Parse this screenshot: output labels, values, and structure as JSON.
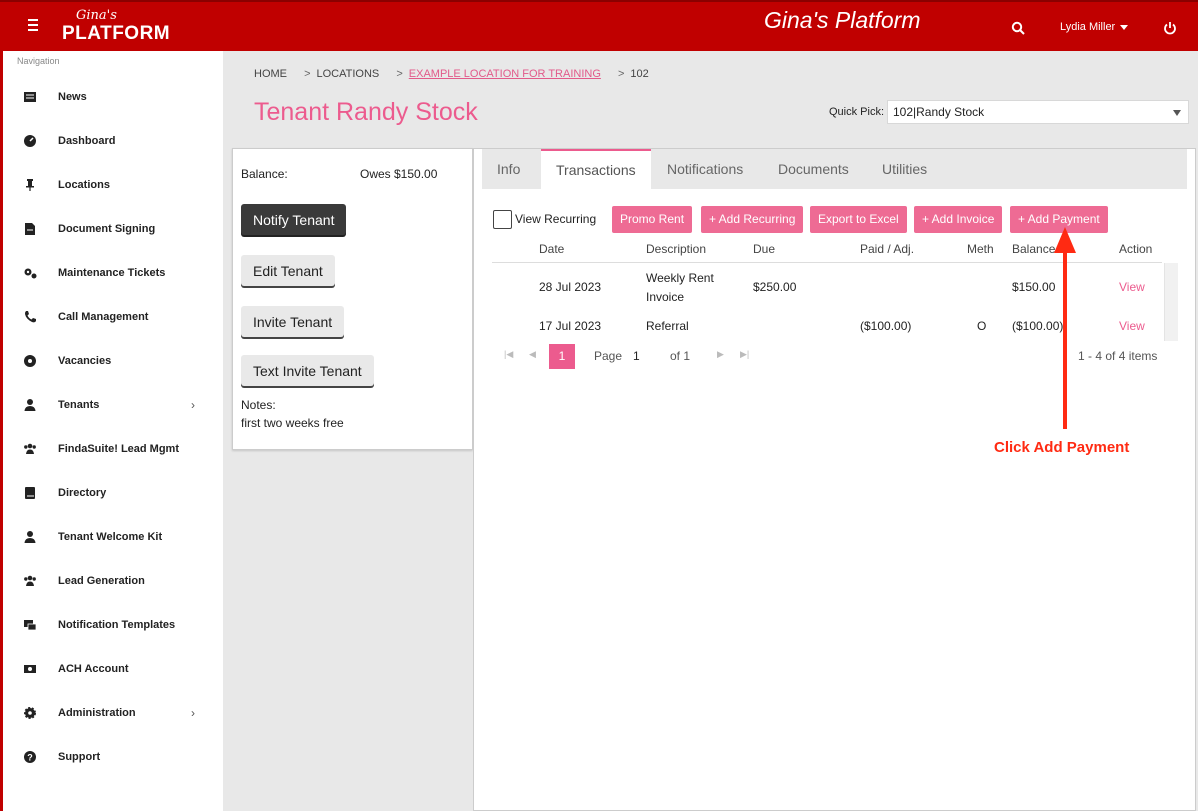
{
  "header": {
    "logo_script": "Gina's",
    "logo_main": "PLATFORM",
    "app_title": "Gina's Platform",
    "user_name": "Lydia Miller",
    "menu_icon": "hamburger-icon",
    "search_icon": "search-icon",
    "power_icon": "power-icon"
  },
  "sidebar": {
    "caption": "Navigation",
    "items": [
      {
        "label": "News",
        "icon": "news-icon"
      },
      {
        "label": "Dashboard",
        "icon": "dashboard-icon"
      },
      {
        "label": "Locations",
        "icon": "pin-icon"
      },
      {
        "label": "Document Signing",
        "icon": "document-icon"
      },
      {
        "label": "Maintenance Tickets",
        "icon": "gears-icon"
      },
      {
        "label": "Call Management",
        "icon": "phone-icon"
      },
      {
        "label": "Vacancies",
        "icon": "vacancy-icon"
      },
      {
        "label": "Tenants",
        "icon": "user-icon",
        "has_children": true
      },
      {
        "label": "FindaSuite! Lead Mgmt",
        "icon": "users-icon"
      },
      {
        "label": "Directory",
        "icon": "book-icon"
      },
      {
        "label": "Tenant Welcome Kit",
        "icon": "user-icon"
      },
      {
        "label": "Lead Generation",
        "icon": "users-icon"
      },
      {
        "label": "Notification Templates",
        "icon": "templates-icon"
      },
      {
        "label": "ACH Account",
        "icon": "money-icon"
      },
      {
        "label": "Administration",
        "icon": "gear-icon",
        "has_children": true
      },
      {
        "label": "Support",
        "icon": "help-icon"
      }
    ]
  },
  "breadcrumb": {
    "home": "HOME",
    "locations": "LOCATIONS",
    "location": "EXAMPLE LOCATION FOR TRAINING",
    "unit": "102",
    "separator": ">"
  },
  "page": {
    "title": "Tenant Randy Stock",
    "quick_pick_label": "Quick Pick:",
    "quick_pick_value": "102|Randy Stock"
  },
  "tenant_card": {
    "balance_label": "Balance:",
    "balance_value": "Owes $150.00",
    "notify_label": "Notify Tenant",
    "edit_label": "Edit Tenant",
    "invite_label": "Invite Tenant",
    "text_invite_label": "Text Invite Tenant",
    "notes_label": "Notes:",
    "notes_value": "first two weeks free"
  },
  "tabs": [
    "Info",
    "Transactions",
    "Notifications",
    "Documents",
    "Utilities"
  ],
  "active_tab": "Transactions",
  "toolbar": {
    "view_recurring_label": "View Recurring",
    "view_recurring_checked": false,
    "promo_rent": "Promo Rent",
    "add_recurring": "+ Add Recurring",
    "export_excel": "Export to Excel",
    "add_invoice": "+ Add Invoice",
    "add_payment": "+ Add Payment"
  },
  "table": {
    "columns": [
      "Date",
      "Description",
      "Due",
      "Paid / Adj.",
      "Meth",
      "Balance",
      "Action"
    ],
    "rows": [
      {
        "date": "28 Jul 2023",
        "desc_line1": "Weekly Rent",
        "desc_line2": "Invoice",
        "due": "$250.00",
        "paid": "",
        "meth": "",
        "balance": "$150.00",
        "action": "View"
      },
      {
        "date": "17 Jul 2023",
        "desc_line1": "Referral",
        "desc_line2": "",
        "due": "",
        "paid": "($100.00)",
        "meth": "O",
        "balance": "($100.00)",
        "action": "View"
      }
    ]
  },
  "pager": {
    "current": "1",
    "page_label": "Page",
    "page_value": "1",
    "of_label": "of 1",
    "summary": "1 - 4 of 4 items"
  },
  "annotation": {
    "text": "Click Add Payment",
    "color": "#ff2a12"
  },
  "colors": {
    "header": "#c00000",
    "accent": "#ec5b8e",
    "button_pink": "#ee6b94"
  }
}
